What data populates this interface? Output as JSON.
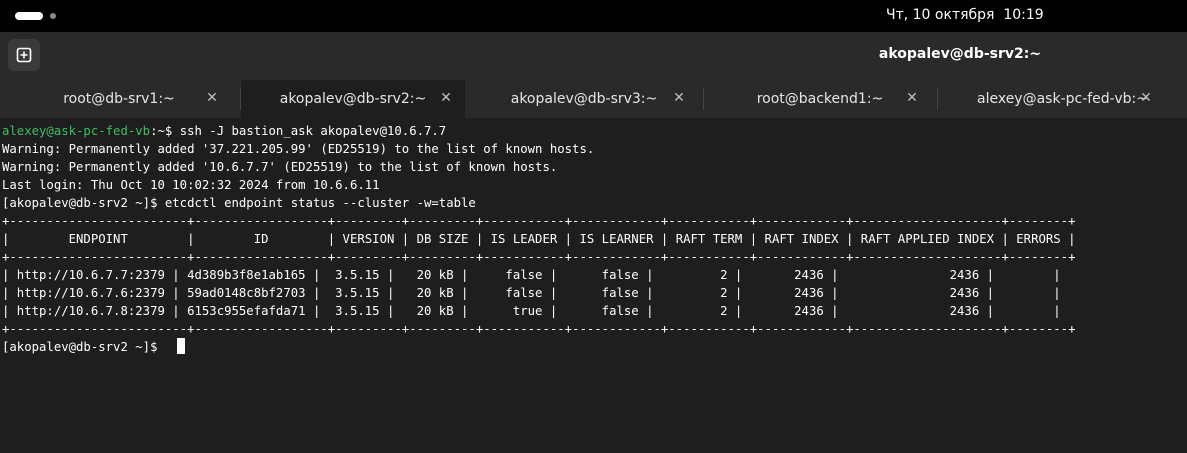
{
  "system_bar": {
    "clock": "Чт, 10 октября  10:19"
  },
  "header": {
    "title": "akopalev@db-srv2:~",
    "new_tab_icon": "plus-square-icon"
  },
  "tabs": [
    {
      "label": "root@db-srv1:~",
      "active": false
    },
    {
      "label": "akopalev@db-srv2:~",
      "active": true
    },
    {
      "label": "akopalev@db-srv3:~",
      "active": false
    },
    {
      "label": "root@backend1:~",
      "active": false
    },
    {
      "label": "alexey@ask-pc-fed-vb:~",
      "active": false
    }
  ],
  "terminal": {
    "first_prompt_user": "alexey@ask-pc-fed-vb",
    "first_prompt_rest": ":~$ ssh -J bastion_ask akopalev@10.6.7.7",
    "lines": [
      "Warning: Permanently added '37.221.205.99' (ED25519) to the list of known hosts.",
      "Warning: Permanently added '10.6.7.7' (ED25519) to the list of known hosts.",
      "Last login: Thu Oct 10 10:02:32 2024 from 10.6.6.11",
      "[akopalev@db-srv2 ~]$ etcdctl endpoint status --cluster -w=table",
      "+------------------------+------------------+---------+---------+-----------+------------+-----------+------------+--------------------+--------+",
      "|        ENDPOINT        |        ID        | VERSION | DB SIZE | IS LEADER | IS LEARNER | RAFT TERM | RAFT INDEX | RAFT APPLIED INDEX | ERRORS |",
      "+------------------------+------------------+---------+---------+-----------+------------+-----------+------------+--------------------+--------+",
      "| http://10.6.7.7:2379 | 4d389b3f8e1ab165 |  3.5.15 |   20 kB |     false |      false |         2 |       2436 |               2436 |        |",
      "| http://10.6.7.6:2379 | 59ad0148c8bf2703 |  3.5.15 |   20 kB |     false |      false |         2 |       2436 |               2436 |        |",
      "| http://10.6.7.8:2379 | 6153c955efafda71 |  3.5.15 |   20 kB |      true |      false |         2 |       2436 |               2436 |        |",
      "+------------------------+------------------+---------+---------+-----------+------------+-----------+------------+--------------------+--------+",
      "[akopalev@db-srv2 ~]$ "
    ]
  },
  "colors": {
    "background": "#1e1e1e",
    "prompt_user": "#3fbf5f",
    "text": "#ffffff"
  }
}
